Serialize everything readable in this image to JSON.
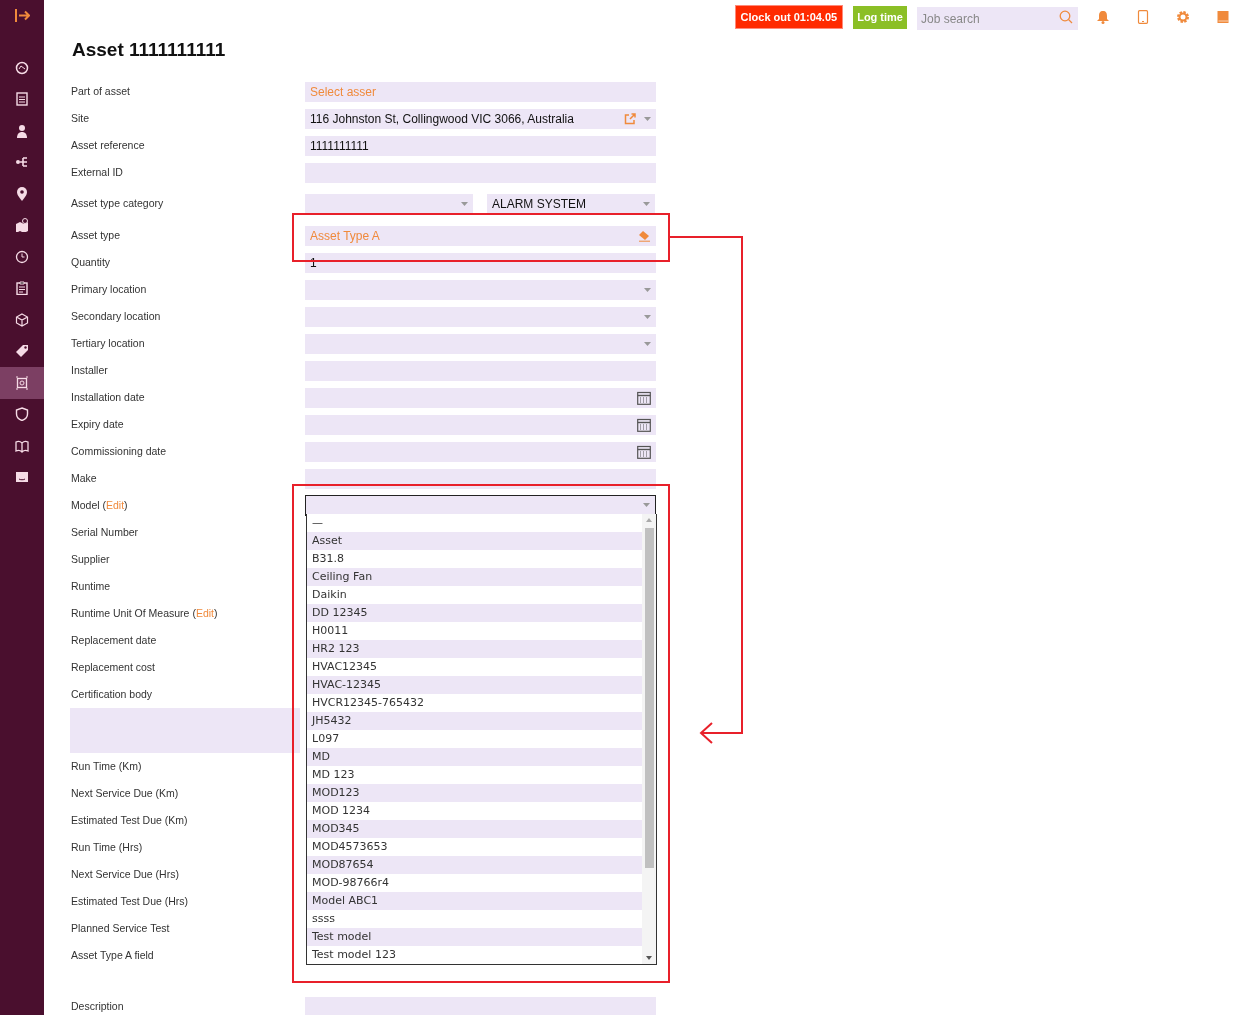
{
  "sidebar": {
    "items": [
      {
        "selected": false
      },
      {
        "selected": false
      },
      {
        "selected": false
      },
      {
        "selected": false
      },
      {
        "selected": false
      },
      {
        "selected": false
      },
      {
        "selected": false
      },
      {
        "selected": false
      },
      {
        "selected": false
      },
      {
        "selected": false
      },
      {
        "selected": true
      },
      {
        "selected": false
      },
      {
        "selected": false
      },
      {
        "selected": false
      }
    ]
  },
  "topbar": {
    "clock_out": "Clock out 01:04.05",
    "log_time": "Log time",
    "search": {
      "placeholder": "Job search"
    }
  },
  "title": "Asset 1111111111",
  "form": [
    {
      "label": "Part of asset",
      "field": {
        "kind": "text",
        "placeholder": "Select asser"
      }
    },
    {
      "label": "Site",
      "field": {
        "kind": "site",
        "value": "116 Johnston St, Collingwood VIC 3066, Australia"
      }
    },
    {
      "label": "Asset reference",
      "field": {
        "kind": "text",
        "value": "1111111111"
      }
    },
    {
      "label": "External ID",
      "field": {
        "kind": "text"
      }
    },
    {
      "label": "Asset type category",
      "tall": true,
      "field": {
        "kind": "double-select",
        "second_value": "ALARM SYSTEM"
      }
    },
    {
      "label": "Asset type",
      "field": {
        "kind": "lookup",
        "value": "Asset Type A"
      }
    },
    {
      "label": "Quantity",
      "field": {
        "kind": "text",
        "value": "1"
      }
    },
    {
      "label": "Primary location",
      "field": {
        "kind": "select"
      }
    },
    {
      "label": "Secondary location",
      "field": {
        "kind": "select"
      }
    },
    {
      "label": "Tertiary location",
      "field": {
        "kind": "select"
      }
    },
    {
      "label": "Installer",
      "field": {
        "kind": "text"
      }
    },
    {
      "label": "Installation date",
      "field": {
        "kind": "date"
      }
    },
    {
      "label": "Expiry date",
      "field": {
        "kind": "date"
      }
    },
    {
      "label": "Commissioning date",
      "field": {
        "kind": "date"
      }
    },
    {
      "label": "Make",
      "field": {
        "kind": "text"
      }
    },
    {
      "label": "Model (",
      "link": "Edit",
      "label_end": ")",
      "field": {
        "kind": "open-select",
        "options": [
          "—",
          "Asset",
          "B31.8",
          "Ceiling Fan",
          "Daikin",
          "DD 12345",
          "H0011",
          "HR2 123",
          "HVAC12345",
          "HVAC-12345",
          "HVCR12345-765432",
          "JH5432",
          "L097",
          "MD",
          "MD 123",
          "MOD123",
          "MOD 1234",
          "MOD345",
          "MOD4573653",
          "MOD87654",
          "MOD-98766r4",
          "Model ABC1",
          "ssss",
          "Test model",
          "Test model 123"
        ]
      }
    },
    {
      "label": "Serial Number"
    },
    {
      "label": "Supplier"
    },
    {
      "label": "Runtime"
    },
    {
      "label": "Runtime Unit Of Measure (",
      "link": "Edit",
      "label_end": ")"
    },
    {
      "label": "Replacement date"
    },
    {
      "label": "Replacement cost"
    },
    {
      "label": "Certification body"
    },
    {
      "kind": "block"
    },
    {
      "label": "Run Time (Km)"
    },
    {
      "label": "Next Service Due (Km)"
    },
    {
      "label": "Estimated Test Due (Km)"
    },
    {
      "label": "Run Time (Hrs)"
    },
    {
      "label": "Next Service Due (Hrs)"
    },
    {
      "label": "Estimated Test Due (Hrs)"
    },
    {
      "label": "Planned Service Test"
    },
    {
      "label": "Asset Type A field"
    },
    {
      "kind": "spacer"
    },
    {
      "label": "Description",
      "field": {
        "kind": "text"
      }
    }
  ]
}
